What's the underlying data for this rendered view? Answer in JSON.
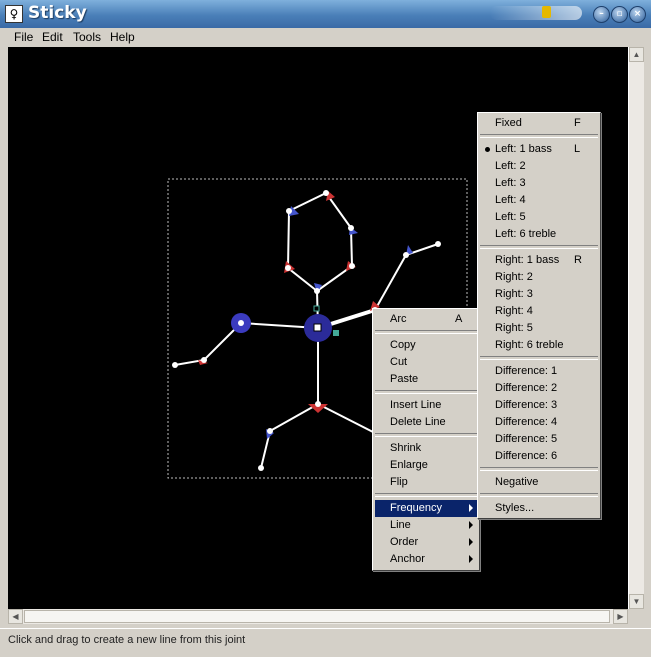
{
  "window": {
    "title": "Sticky",
    "icon": "stick-figure-app-icon",
    "controls": [
      "minimize",
      "maximize",
      "close"
    ]
  },
  "menubar": [
    "File",
    "Edit",
    "Tools",
    "Help"
  ],
  "colors": {
    "canvas": "#000000",
    "line": "#ffffff",
    "arc_red": "#cc3333",
    "arc_blue": "#4455cc",
    "highlight": "#0a246a"
  },
  "context_menu": {
    "items": [
      {
        "label": "Arc",
        "accel": "A"
      },
      {
        "label": "Copy"
      },
      {
        "label": "Cut"
      },
      {
        "label": "Paste"
      },
      {
        "label": "Insert Line"
      },
      {
        "label": "Delete Line"
      },
      {
        "label": "Shrink"
      },
      {
        "label": "Enlarge"
      },
      {
        "label": "Flip"
      },
      {
        "label": "Frequency",
        "submenu": true,
        "highlighted": true
      },
      {
        "label": "Line",
        "submenu": true
      },
      {
        "label": "Order",
        "submenu": true
      },
      {
        "label": "Anchor",
        "submenu": true
      }
    ]
  },
  "frequency_submenu": {
    "items": [
      {
        "label": "Fixed",
        "accel": "F"
      },
      {
        "label": "Left: 1 bass",
        "accel": "L",
        "checked": true
      },
      {
        "label": "Left: 2"
      },
      {
        "label": "Left: 3"
      },
      {
        "label": "Left: 4"
      },
      {
        "label": "Left: 5"
      },
      {
        "label": "Left: 6 treble"
      },
      {
        "label": "Right: 1 bass",
        "accel": "R"
      },
      {
        "label": "Right: 2"
      },
      {
        "label": "Right: 3"
      },
      {
        "label": "Right: 4"
      },
      {
        "label": "Right: 5"
      },
      {
        "label": "Right: 6 treble"
      },
      {
        "label": "Difference: 1"
      },
      {
        "label": "Difference: 2"
      },
      {
        "label": "Difference: 3"
      },
      {
        "label": "Difference: 4"
      },
      {
        "label": "Difference: 5"
      },
      {
        "label": "Difference: 6"
      },
      {
        "label": "Negative"
      },
      {
        "label": "Styles..."
      }
    ]
  },
  "status": "Click and drag to create a new line from this joint"
}
